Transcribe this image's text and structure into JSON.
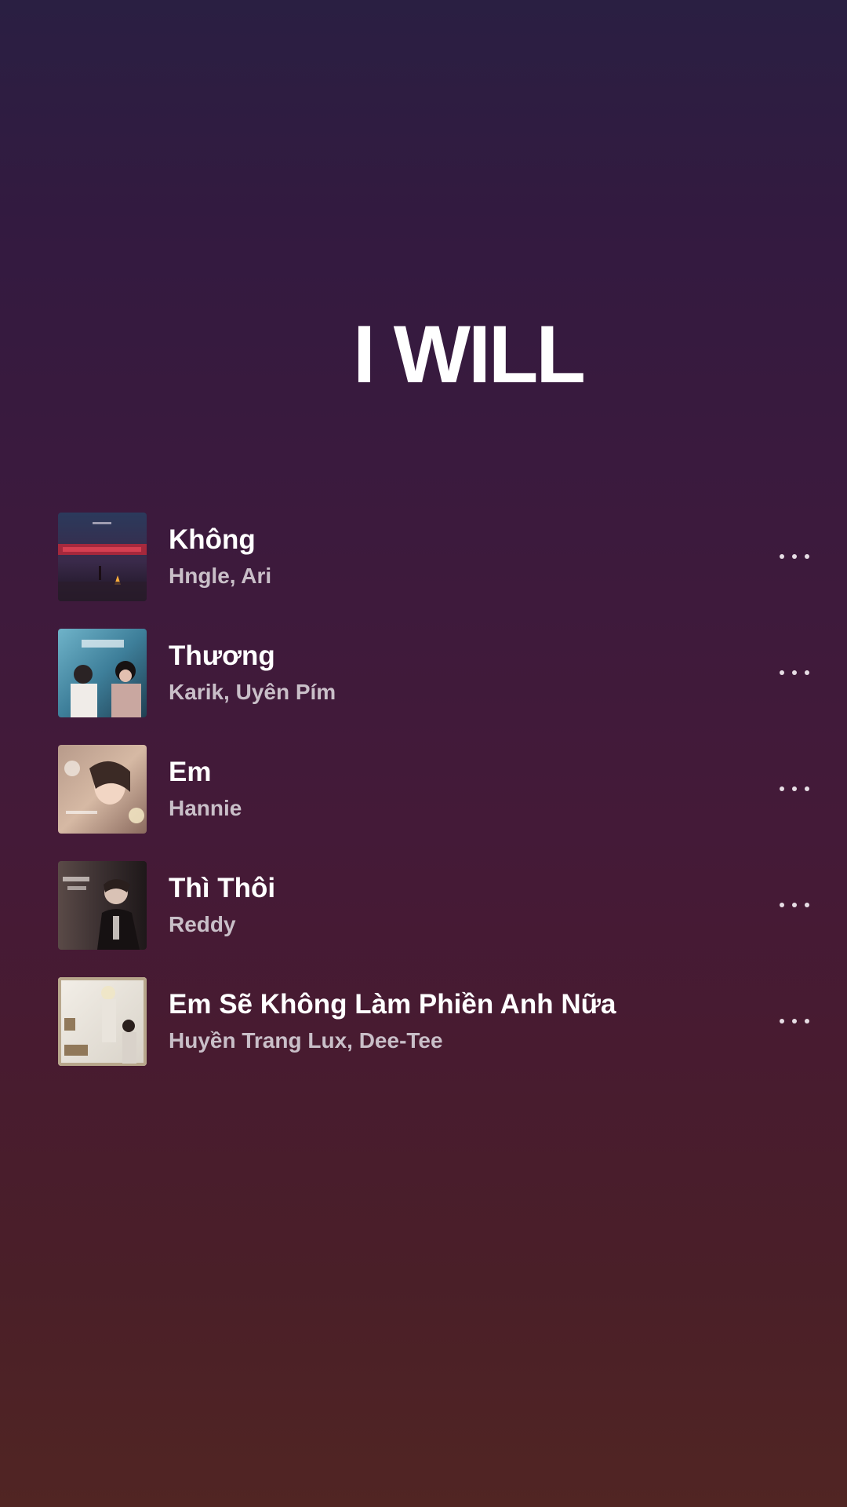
{
  "playlist": {
    "title": "I WILL"
  },
  "tracks": [
    {
      "title": "Không",
      "artist": "Hngle, Ari",
      "cover": "cover-khong"
    },
    {
      "title": "Thương",
      "artist": "Karik, Uyên Pím",
      "cover": "cover-thuong"
    },
    {
      "title": "Em",
      "artist": "Hannie",
      "cover": "cover-em"
    },
    {
      "title": "Thì Thôi",
      "artist": "Reddy",
      "cover": "cover-thi-thoi"
    },
    {
      "title": "Em Sẽ Không Làm Phiền Anh Nữa",
      "artist": "Huyền Trang Lux, Dee-Tee",
      "cover": "cover-em-se-khong"
    }
  ],
  "icons": {
    "more": "more-options-icon"
  },
  "colors": {
    "text_primary": "#ffffff",
    "text_secondary": "#c9bfc8",
    "background_top": "#2a1f42",
    "background_bottom": "#512523"
  }
}
